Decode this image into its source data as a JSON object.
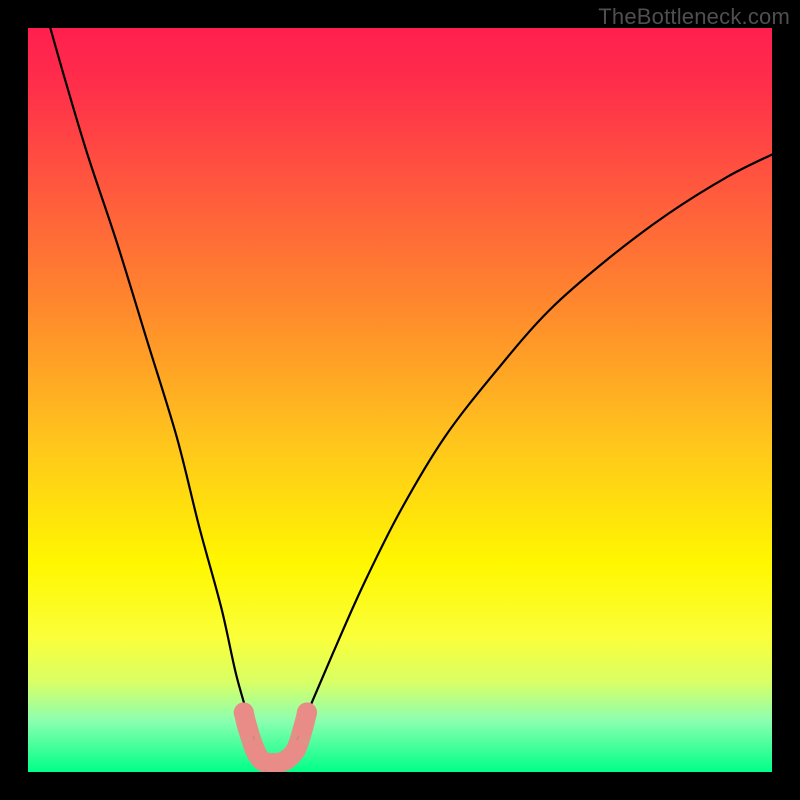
{
  "watermark": "TheBottleneck.com",
  "chart_data": {
    "type": "line",
    "title": "",
    "xlabel": "",
    "ylabel": "",
    "xlim": [
      0,
      100
    ],
    "ylim": [
      0,
      100
    ],
    "grid": false,
    "legend": false,
    "series": [
      {
        "name": "curve",
        "x": [
          3,
          5,
          8,
          12,
          16,
          20,
          23,
          26,
          28,
          30,
          31,
          32,
          33,
          34,
          36,
          38,
          41,
          45,
          50,
          56,
          63,
          70,
          78,
          86,
          94,
          100
        ],
        "values": [
          100,
          93,
          83,
          71,
          58,
          45,
          33,
          22,
          13,
          6,
          2,
          0,
          0,
          1,
          4,
          9,
          16,
          25,
          35,
          45,
          54,
          62,
          69,
          75,
          80,
          83
        ]
      }
    ],
    "markers": {
      "name": "highlight-beads",
      "points": [
        {
          "x": 29.0,
          "y": 8.0
        },
        {
          "x": 29.5,
          "y": 6.0
        },
        {
          "x": 30.5,
          "y": 3.0
        },
        {
          "x": 31.5,
          "y": 1.5
        },
        {
          "x": 33.0,
          "y": 1.2
        },
        {
          "x": 34.5,
          "y": 1.5
        },
        {
          "x": 36.0,
          "y": 3.0
        },
        {
          "x": 37.0,
          "y": 6.0
        },
        {
          "x": 37.5,
          "y": 8.0
        }
      ],
      "color": "#e98b86",
      "radius_px": 10
    },
    "background_gradient": {
      "direction": "top-to-bottom",
      "stops": [
        {
          "pos": 0.0,
          "color": "#ff1f4e"
        },
        {
          "pos": 0.5,
          "color": "#ffc31d"
        },
        {
          "pos": 0.75,
          "color": "#fff700"
        },
        {
          "pos": 1.0,
          "color": "#00ff88"
        }
      ]
    }
  }
}
